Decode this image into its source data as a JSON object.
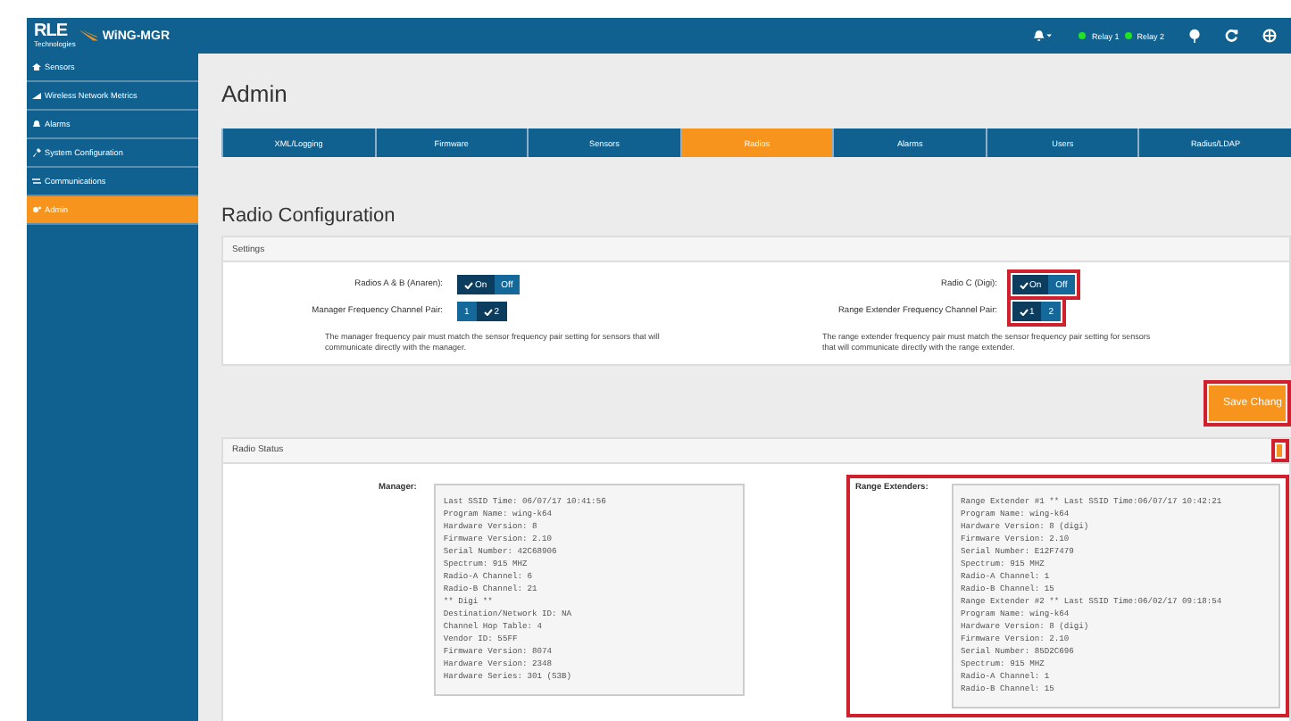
{
  "brand": {
    "logo": "RLE",
    "subtitle": "Technologies",
    "product": "WiNG-MGR"
  },
  "header": {
    "relays": [
      {
        "label": "Relay 1",
        "color": "#22e022"
      },
      {
        "label": "Relay 2",
        "color": "#22e022"
      }
    ]
  },
  "sidebar": {
    "items": [
      {
        "label": "Sensors",
        "selected": false
      },
      {
        "label": "Wireless Network Metrics",
        "selected": false
      },
      {
        "label": "Alarms",
        "selected": false
      },
      {
        "label": "System Configuration",
        "selected": false
      },
      {
        "label": "Communications",
        "selected": false
      },
      {
        "label": "Admin",
        "selected": true
      }
    ]
  },
  "page_title": "Admin",
  "tabs": [
    {
      "label": "XML/Logging",
      "selected": false
    },
    {
      "label": "Firmware",
      "selected": false
    },
    {
      "label": "Sensors",
      "selected": false
    },
    {
      "label": "Radios",
      "selected": true
    },
    {
      "label": "Alarms",
      "selected": false
    },
    {
      "label": "Users",
      "selected": false
    },
    {
      "label": "Radius/LDAP",
      "selected": false
    }
  ],
  "section_title": "Radio Configuration",
  "settings": {
    "title": "Settings",
    "columns": [
      {
        "fields": [
          {
            "label": "Radios A & B (Anaren):",
            "highlighted": false,
            "options": [
              {
                "label": "On",
                "selected": true
              },
              {
                "label": "Off",
                "selected": false
              }
            ]
          },
          {
            "label": "Manager Frequency Channel Pair:",
            "highlighted": false,
            "options": [
              {
                "label": "1",
                "selected": false
              },
              {
                "label": "2",
                "selected": true
              }
            ]
          }
        ],
        "note": "The manager frequency pair must match the sensor frequency pair setting for sensors that will communicate directly with the manager."
      },
      {
        "fields": [
          {
            "label": "Radio C (Digi):",
            "highlighted": true,
            "options": [
              {
                "label": "On",
                "selected": true
              },
              {
                "label": "Off",
                "selected": false
              }
            ]
          },
          {
            "label": "Range Extender Frequency Channel Pair:",
            "highlighted": true,
            "options": [
              {
                "label": "1",
                "selected": true
              },
              {
                "label": "2",
                "selected": false
              }
            ]
          }
        ],
        "note": "The range extender frequency pair must match the sensor frequency pair setting for sensors that will communicate directly with the range extender."
      }
    ]
  },
  "save_button": {
    "label": "Save Chang",
    "highlighted": true
  },
  "status": {
    "title": "Radio Status",
    "icon_highlighted": true,
    "blocks": [
      {
        "label": "Manager:",
        "highlighted": false,
        "lines": [
          "Last SSID Time: 06/07/17 10:41:56",
          "Program Name: wing-k64",
          "Hardware Version: 8",
          "Firmware Version: 2.10",
          "Serial Number: 42C68906",
          "Spectrum: 915 MHZ",
          "Radio-A Channel: 6",
          "Radio-B Channel: 21",
          "** Digi **",
          "Destination/Network ID: NA",
          "Channel Hop Table: 4",
          "Vendor ID: 55FF",
          "Firmware Version: 8074",
          "Hardware Version: 2348",
          "Hardware Series: 301 (S3B)"
        ]
      },
      {
        "label": "Range Extenders:",
        "highlighted": true,
        "lines": [
          "Range Extender #1 ** Last SSID Time:06/07/17 10:42:21",
          "Program Name: wing-k64",
          "Hardware Version: 8 (digi)",
          "Firmware Version: 2.10",
          "Serial Number: E12F7479",
          "Spectrum: 915 MHZ",
          "Radio-A Channel: 1",
          "Radio-B Channel: 15",
          "Range Extender #2 ** Last SSID Time:06/02/17 09:18:54",
          "Program Name: wing-k64",
          "Hardware Version: 8 (digi)",
          "Firmware Version: 2.10",
          "Serial Number: 85D2C696",
          "Spectrum: 915 MHZ",
          "Radio-A Channel: 1",
          "Radio-B Channel: 15"
        ]
      }
    ]
  }
}
